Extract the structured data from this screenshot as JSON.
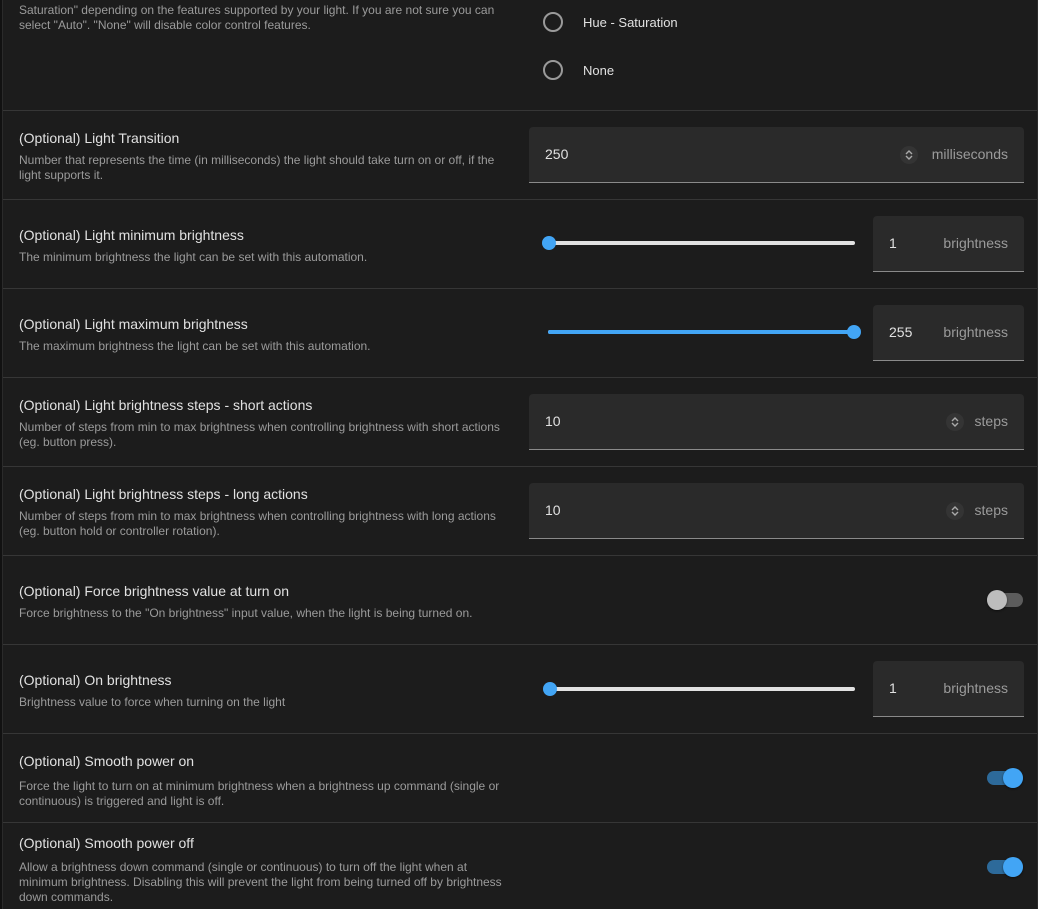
{
  "colors": {
    "accent": "#42a5f5",
    "background": "#1c1c1c",
    "field": "#2a2a2a"
  },
  "color_mode": {
    "desc": "Saturation\" depending on the features supported by your light. If you are not sure you can select \"Auto\". \"None\" will disable color control features.",
    "options": [
      {
        "label": "Hue - Saturation",
        "selected": false
      },
      {
        "label": "None",
        "selected": false
      }
    ]
  },
  "transition": {
    "title": "(Optional) Light Transition",
    "desc": "Number that represents the time (in milliseconds) the light should take turn on or off, if the light supports it.",
    "value": "250",
    "unit": "milliseconds"
  },
  "min_brightness": {
    "title": "(Optional) Light minimum brightness",
    "desc": "The minimum brightness the light can be set with this automation.",
    "value": "1",
    "unit": "brightness",
    "slider_fraction": 0
  },
  "max_brightness": {
    "title": "(Optional) Light maximum brightness",
    "desc": "The maximum brightness the light can be set with this automation.",
    "value": "255",
    "unit": "brightness",
    "slider_fraction": 1
  },
  "steps_short": {
    "title": "(Optional) Light brightness steps - short actions",
    "desc": "Number of steps from min to max brightness when controlling brightness with short actions (eg. button press).",
    "value": "10",
    "unit": "steps"
  },
  "steps_long": {
    "title": "(Optional) Light brightness steps - long actions",
    "desc": "Number of steps from min to max brightness when controlling brightness with long actions (eg. button hold or controller rotation).",
    "value": "10",
    "unit": "steps"
  },
  "force_brightness": {
    "title": "(Optional) Force brightness value at turn on",
    "desc": "Force brightness to the \"On brightness\" input value, when the light is being turned on.",
    "enabled": false
  },
  "on_brightness": {
    "title": "(Optional) On brightness",
    "desc": "Brightness value to force when turning on the light",
    "value": "1",
    "unit": "brightness",
    "slider_fraction": 0
  },
  "smooth_on": {
    "title": "(Optional) Smooth power on",
    "desc": "Force the light to turn on at minimum brightness when a brightness up command (single or continuous) is triggered and light is off.",
    "enabled": true
  },
  "smooth_off": {
    "title": "(Optional) Smooth power off",
    "desc": "Allow a brightness down command (single or continuous) to turn off the light when at minimum brightness. Disabling this will prevent the light from being turned off by brightness down commands.",
    "enabled": true
  }
}
